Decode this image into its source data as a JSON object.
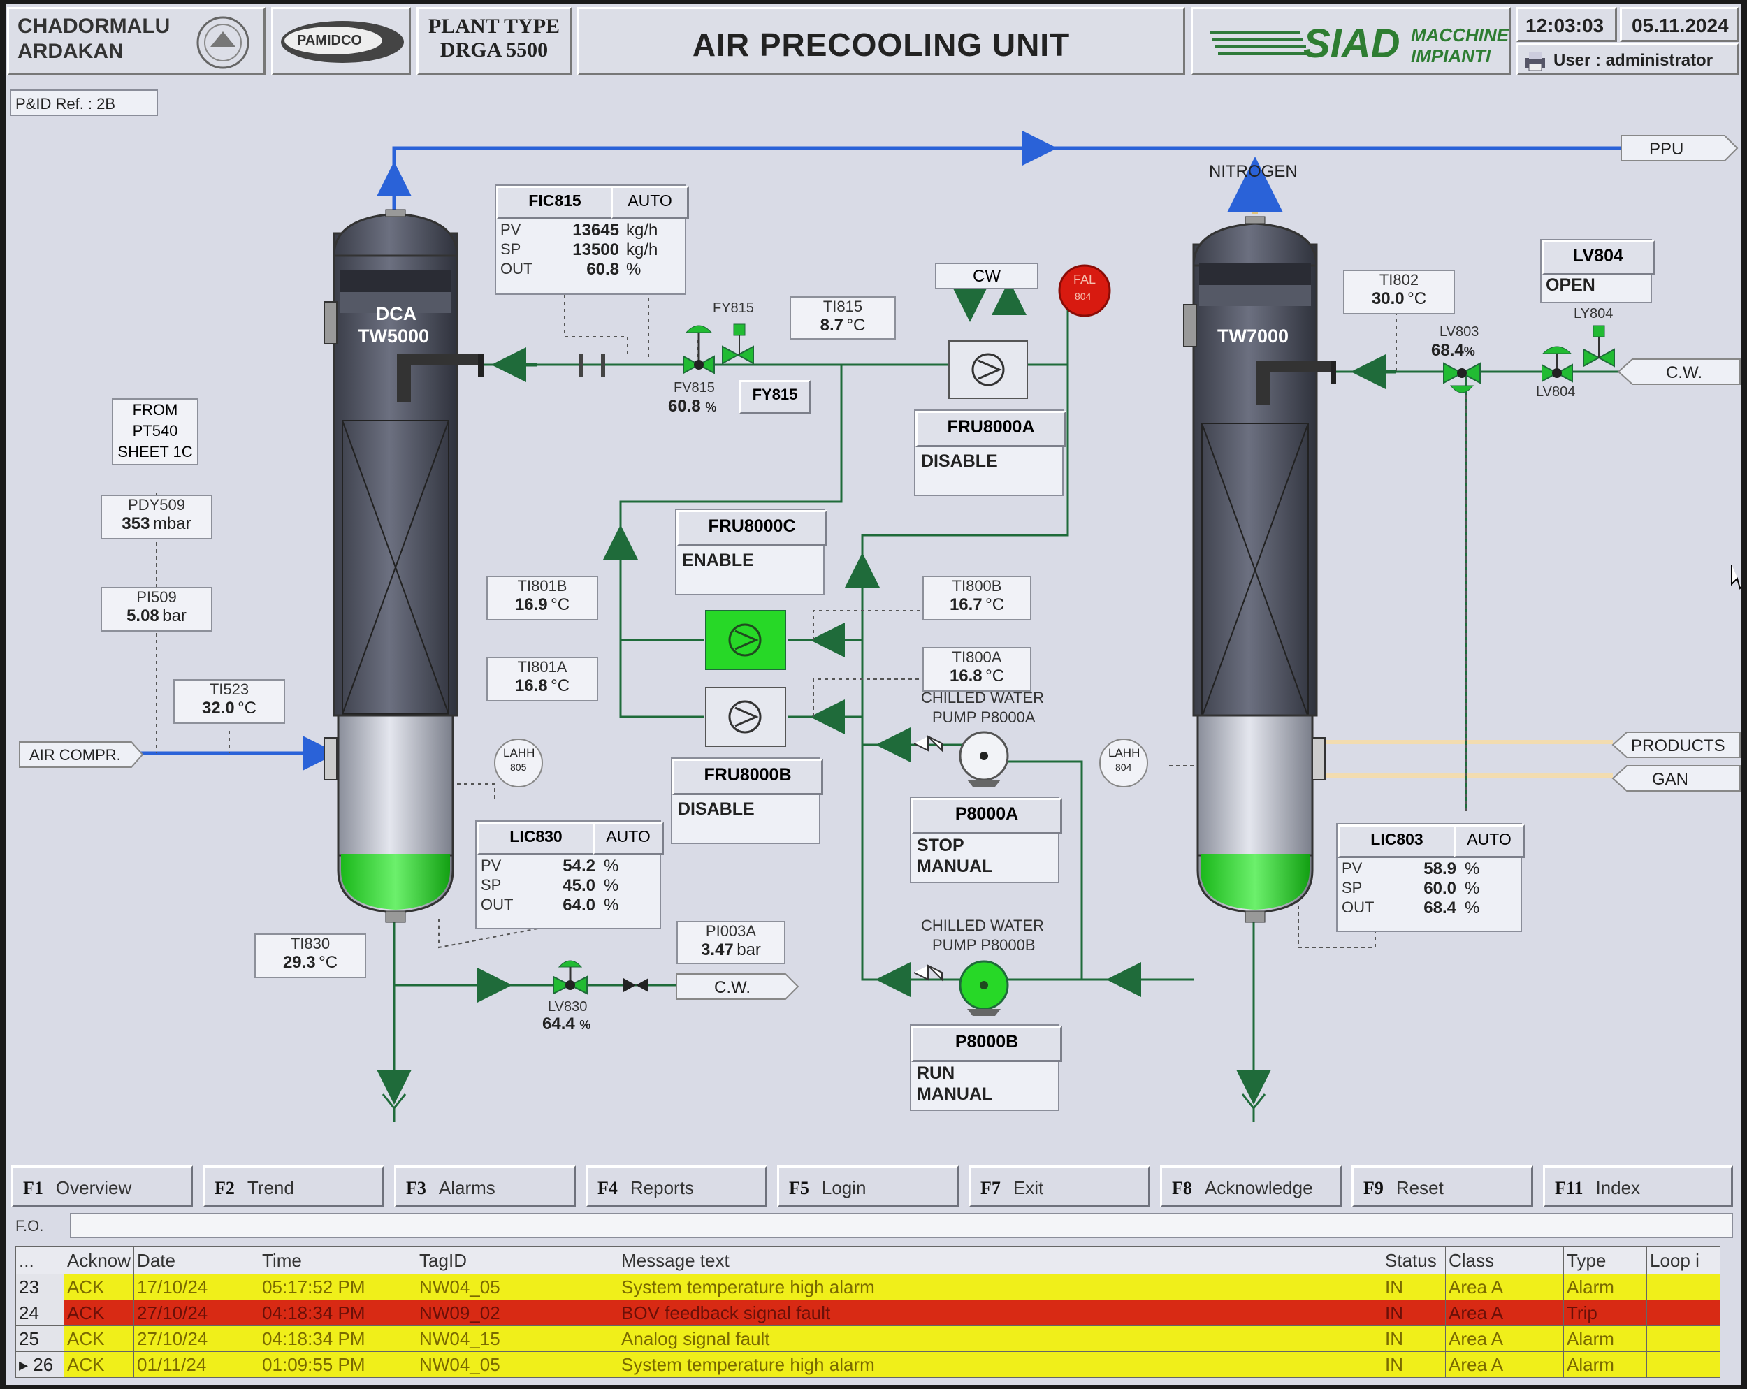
{
  "header": {
    "site_line1": "CHADORMALU",
    "site_line2": "ARDAKAN",
    "partner_logo": "PAMIDCO",
    "plant_type_line1": "PLANT TYPE",
    "plant_type_line2": "DRGA 5500",
    "title": "AIR PRECOOLING UNIT",
    "brand": "SIAD",
    "brand_sub1": "MACCHINE",
    "brand_sub2": "IMPIANTI",
    "time": "12:03:03",
    "date": "05.11.2024",
    "user": "User : administrator"
  },
  "pid_ref": "P&ID Ref. :  2B",
  "streams": {
    "ppu": "PPU",
    "nitrogen": "NITROGEN",
    "cw_top": "CW",
    "cw_right": "C.W.",
    "cw_bottom": "C.W.",
    "air_compr": "AIR COMPR.",
    "products": "PRODUCTS",
    "gan": "GAN"
  },
  "vessels": {
    "dca_line1": "DCA",
    "dca_line2": "TW5000",
    "tw7000": "TW7000"
  },
  "from_box": {
    "l1": "FROM",
    "l2": "PT540",
    "l3": "SHEET 1C"
  },
  "indicators": {
    "pdy509": {
      "tag": "PDY509",
      "value": "353",
      "unit": "mbar"
    },
    "pi509": {
      "tag": "PI509",
      "value": "5.08",
      "unit": "bar"
    },
    "ti523": {
      "tag": "TI523",
      "value": "32.0",
      "unit": "°C"
    },
    "ti815": {
      "tag": "TI815",
      "value": "8.7",
      "unit": "°C"
    },
    "ti802": {
      "tag": "TI802",
      "value": "30.0",
      "unit": "°C"
    },
    "ti801b": {
      "tag": "TI801B",
      "value": "16.9",
      "unit": "°C"
    },
    "ti801a": {
      "tag": "TI801A",
      "value": "16.8",
      "unit": "°C"
    },
    "ti800b": {
      "tag": "TI800B",
      "value": "16.7",
      "unit": "°C"
    },
    "ti800a": {
      "tag": "TI800A",
      "value": "16.8",
      "unit": "°C"
    },
    "ti830": {
      "tag": "TI830",
      "value": "29.3",
      "unit": "°C"
    },
    "pi003a": {
      "tag": "PI003A",
      "value": "3.47",
      "unit": "bar"
    }
  },
  "controllers": {
    "fic815": {
      "tag": "FIC815",
      "mode": "AUTO",
      "pv": "13645",
      "sp": "13500",
      "out": "60.8",
      "unit": "kg/h",
      "out_unit": "%"
    },
    "lic830": {
      "tag": "LIC830",
      "mode": "AUTO",
      "pv": "54.2",
      "sp": "45.0",
      "out": "64.0",
      "unit": "%",
      "out_unit": "%"
    },
    "lic803": {
      "tag": "LIC803",
      "mode": "AUTO",
      "pv": "58.9",
      "sp": "60.0",
      "out": "68.4",
      "unit": "%",
      "out_unit": "%"
    },
    "labels": {
      "pv": "PV",
      "sp": "SP",
      "out": "OUT"
    }
  },
  "valves": {
    "fy815": "FY815",
    "fy815_btn": "FY815",
    "fv815": "FV815",
    "fv815_pct": "60.8",
    "lv803": "LV803",
    "lv803_pct": "68.4",
    "ly804": "LY804",
    "lv804": "LV804",
    "lv830": "LV830",
    "lv830_pct": "64.4",
    "pct": "%"
  },
  "lv804_box": {
    "tag": "LV804",
    "state": "OPEN"
  },
  "alarms_small": {
    "fal_l1": "FAL",
    "fal_l2": "804",
    "lahh805_l1": "LAHH",
    "lahh805_l2": "805",
    "lahh804_l1": "LAHH",
    "lahh804_l2": "804"
  },
  "units": {
    "fru8000a": {
      "tag": "FRU8000A",
      "state": "DISABLE"
    },
    "fru8000c": {
      "tag": "FRU8000C",
      "state": "ENABLE"
    },
    "fru8000b": {
      "tag": "FRU8000B",
      "state": "DISABLE"
    },
    "p8000a": {
      "tag": "P8000A",
      "state1": "STOP",
      "state2": "MANUAL",
      "label1": "CHILLED WATER",
      "label2": "PUMP P8000A"
    },
    "p8000b": {
      "tag": "P8000B",
      "state1": "RUN",
      "state2": "MANUAL",
      "label1": "CHILLED WATER",
      "label2": "PUMP P8000B"
    }
  },
  "fkeys": [
    {
      "key": "F1",
      "label": "Overview"
    },
    {
      "key": "F2",
      "label": "Trend"
    },
    {
      "key": "F3",
      "label": "Alarms"
    },
    {
      "key": "F4",
      "label": "Reports"
    },
    {
      "key": "F5",
      "label": "Login"
    },
    {
      "key": "F7",
      "label": "Exit"
    },
    {
      "key": "F8",
      "label": "Acknowledge"
    },
    {
      "key": "F9",
      "label": "Reset"
    },
    {
      "key": "F11",
      "label": "Index"
    }
  ],
  "fo_label": "F.O.",
  "alarm_table": {
    "columns": [
      "...",
      "Acknow",
      "Date",
      "Time",
      "TagID",
      "Message text",
      "Status",
      "Class",
      "Type",
      "Loop i"
    ],
    "rows": [
      {
        "n": "23",
        "ack": "ACK",
        "date": "17/10/24",
        "time": "05:17:52 PM",
        "tag": "NW04_05",
        "msg": "System temperature high alarm",
        "status": "IN",
        "class": "Area A",
        "type": "Alarm"
      },
      {
        "n": "24",
        "ack": "ACK",
        "date": "27/10/24",
        "time": "04:18:34 PM",
        "tag": "NW09_02",
        "msg": "BOV feedback signal fault",
        "status": "IN",
        "class": "Area A",
        "type": "Trip"
      },
      {
        "n": "25",
        "ack": "ACK",
        "date": "27/10/24",
        "time": "04:18:34 PM",
        "tag": "NW04_15",
        "msg": "Analog signal fault",
        "status": "IN",
        "class": "Area A",
        "type": "Alarm"
      },
      {
        "n": "26",
        "ack": "ACK",
        "date": "01/11/24",
        "time": "01:09:55 PM",
        "tag": "NW04_05",
        "msg": "System temperature high alarm",
        "status": "IN",
        "class": "Area A",
        "type": "Alarm"
      }
    ]
  },
  "colors": {
    "pipe": "#1f6b3a",
    "air_line": "#2a62d8",
    "run_green": "#22dd22",
    "alarm_red": "#d81a10",
    "alarm_yellow": "#f0ef1a"
  }
}
